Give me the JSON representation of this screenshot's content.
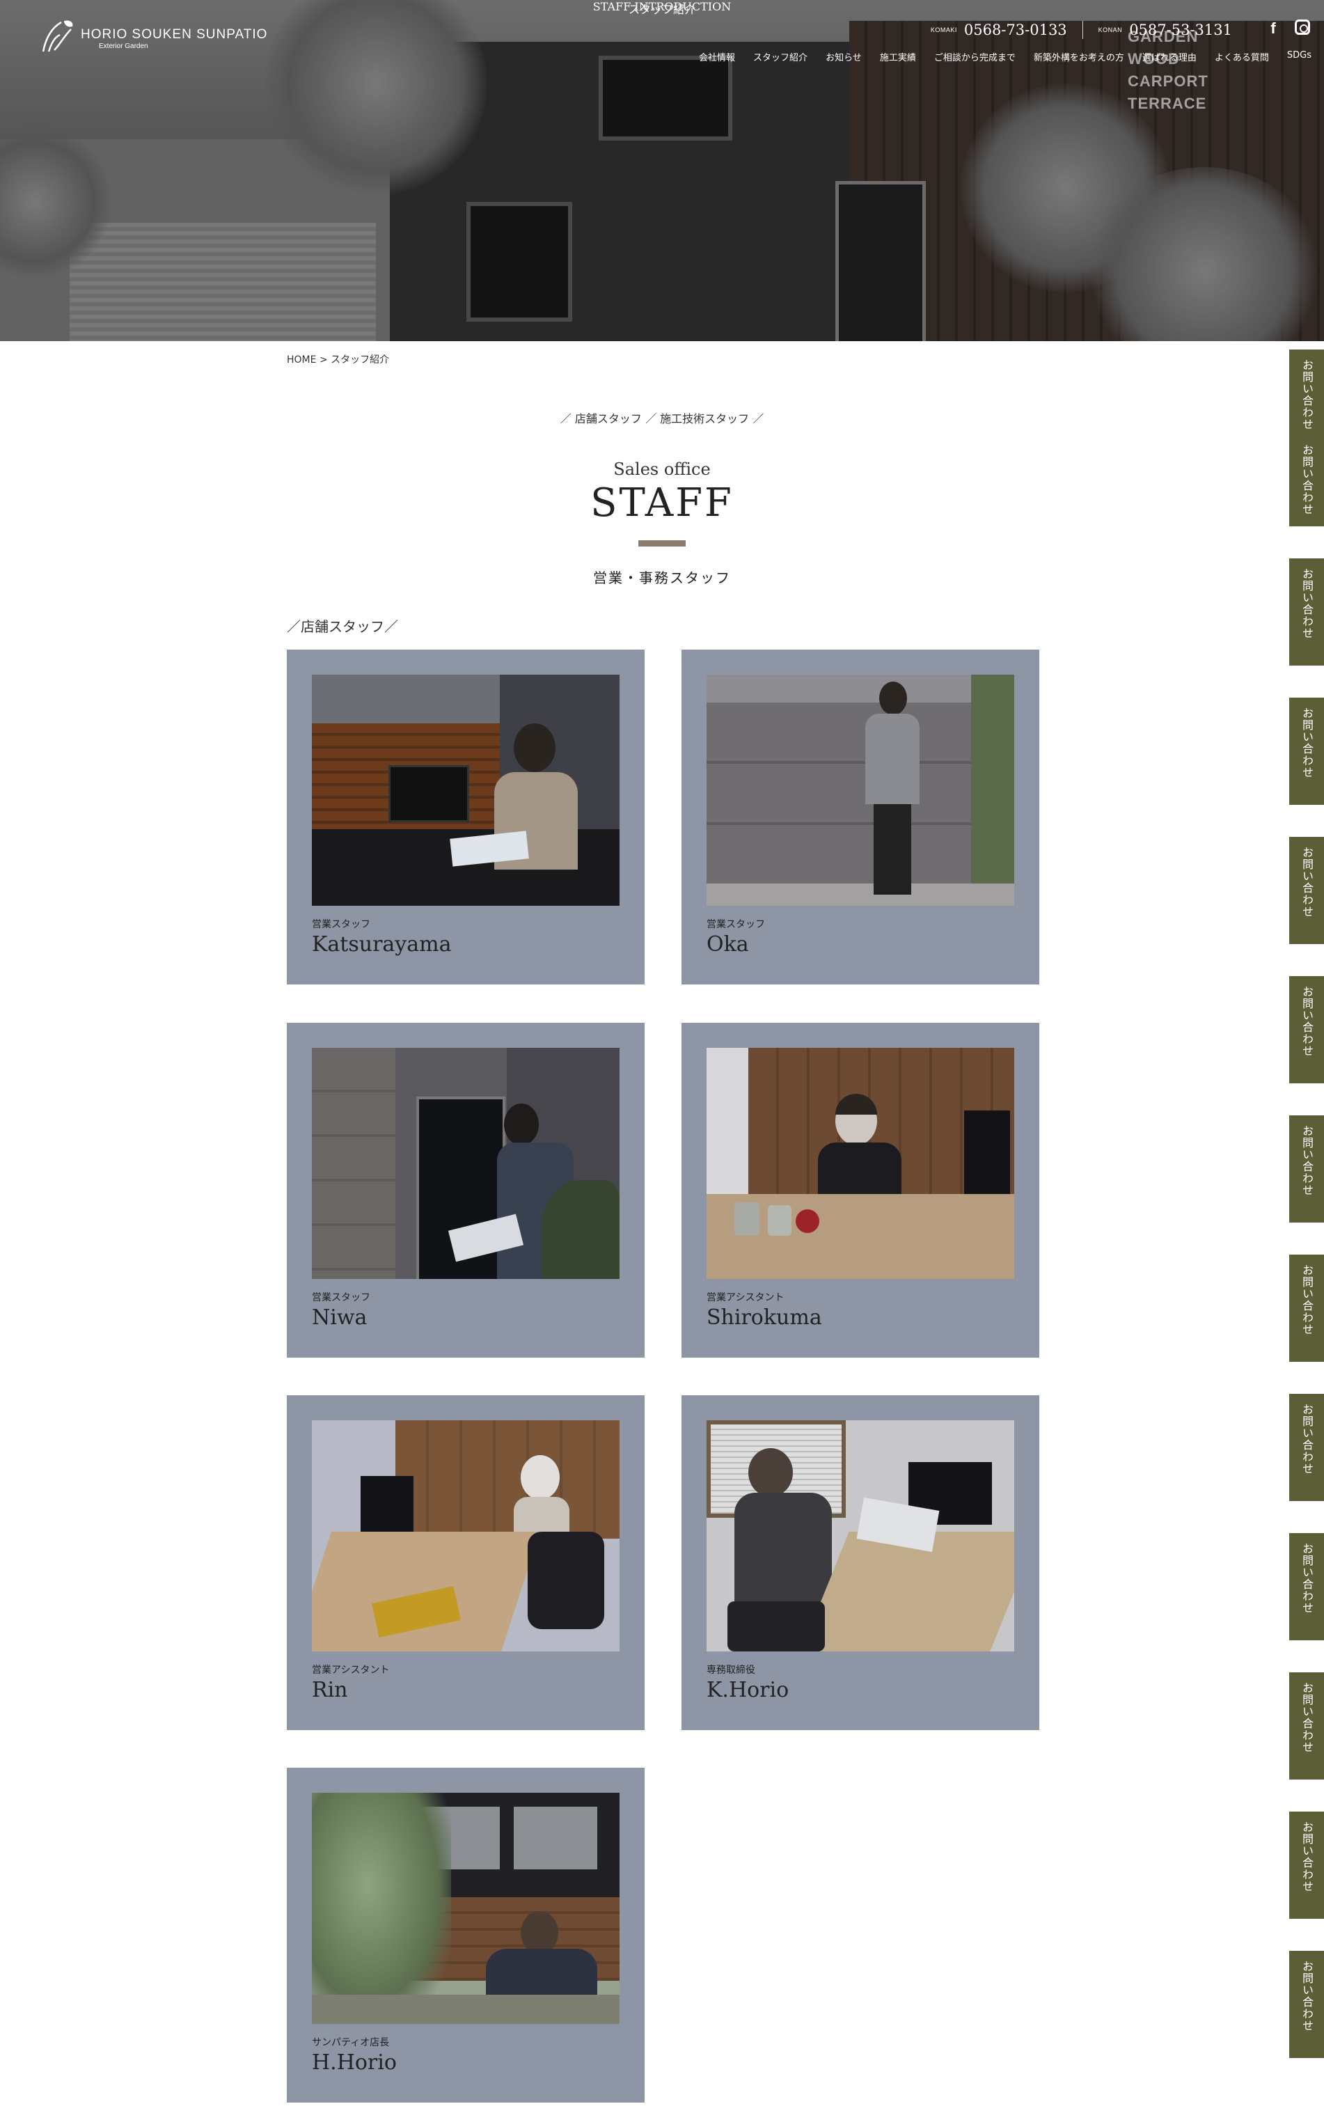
{
  "header": {
    "logo_text": "HORIO SOUKEN SUNPATIO",
    "logo_sub": "Exterior Garden",
    "phones": [
      {
        "area": "KOMAKI",
        "number": "0568-73-0133"
      },
      {
        "area": "KONAN",
        "number": "0587-53-3131"
      }
    ],
    "social": [
      {
        "icon": "facebook-icon",
        "glyph": "f"
      },
      {
        "icon": "instagram-icon",
        "glyph": ""
      }
    ],
    "nav": [
      "会社情報",
      "スタッフ紹介",
      "お知らせ",
      "施工実績",
      "ご相談から完成まで",
      "新築外構をお考えの方",
      "選ばれる理由",
      "よくある質問",
      "SDGs"
    ]
  },
  "hero": {
    "title_en": "STAFF INTRODUCTION",
    "title_ja": "スタッフ紹介",
    "sign_lines": [
      "GARDEN",
      "WOOD",
      "CARPORT",
      "TERRACE"
    ]
  },
  "breadcrumb": {
    "home": "HOME",
    "separator": ">",
    "current": "スタッフ紹介"
  },
  "subnav": {
    "prefix": "／",
    "items": [
      "店舗スタッフ",
      "施工技術スタッフ"
    ],
    "separator": "／",
    "suffix": "／"
  },
  "section": {
    "label_en": "Sales office",
    "title": "STAFF",
    "subtitle": "営業・事務スタッフ",
    "group_label": "／店舗スタッフ／",
    "accent_color": "#8b7d6e"
  },
  "staff": [
    {
      "role": "営業スタッフ",
      "name": "Katsurayama"
    },
    {
      "role": "営業スタッフ",
      "name": "Oka"
    },
    {
      "role": "営業スタッフ",
      "name": "Niwa"
    },
    {
      "role": "営業アシスタント",
      "name": "Shirokuma"
    },
    {
      "role": "営業アシスタント",
      "name": "Rin"
    },
    {
      "role": "専務取締役",
      "name": "K.Horio"
    },
    {
      "role": "サンパティオ店長",
      "name": "H.Horio"
    }
  ],
  "side_tabs": [
    "お問い合わせ お問い合わせ",
    "お問い合わせ",
    "お問い合わせ",
    "お問い合わせ",
    "お問い合わせ",
    "お問い合わせ",
    "お問い合わせ",
    "お問い合わせ",
    "お問い合わせ",
    "お問い合わせ",
    "お問い合わせ",
    "お問い合わせ"
  ],
  "colors": {
    "card_bg": "#8e95a4",
    "side_tab_bg": "#5b5e37"
  }
}
